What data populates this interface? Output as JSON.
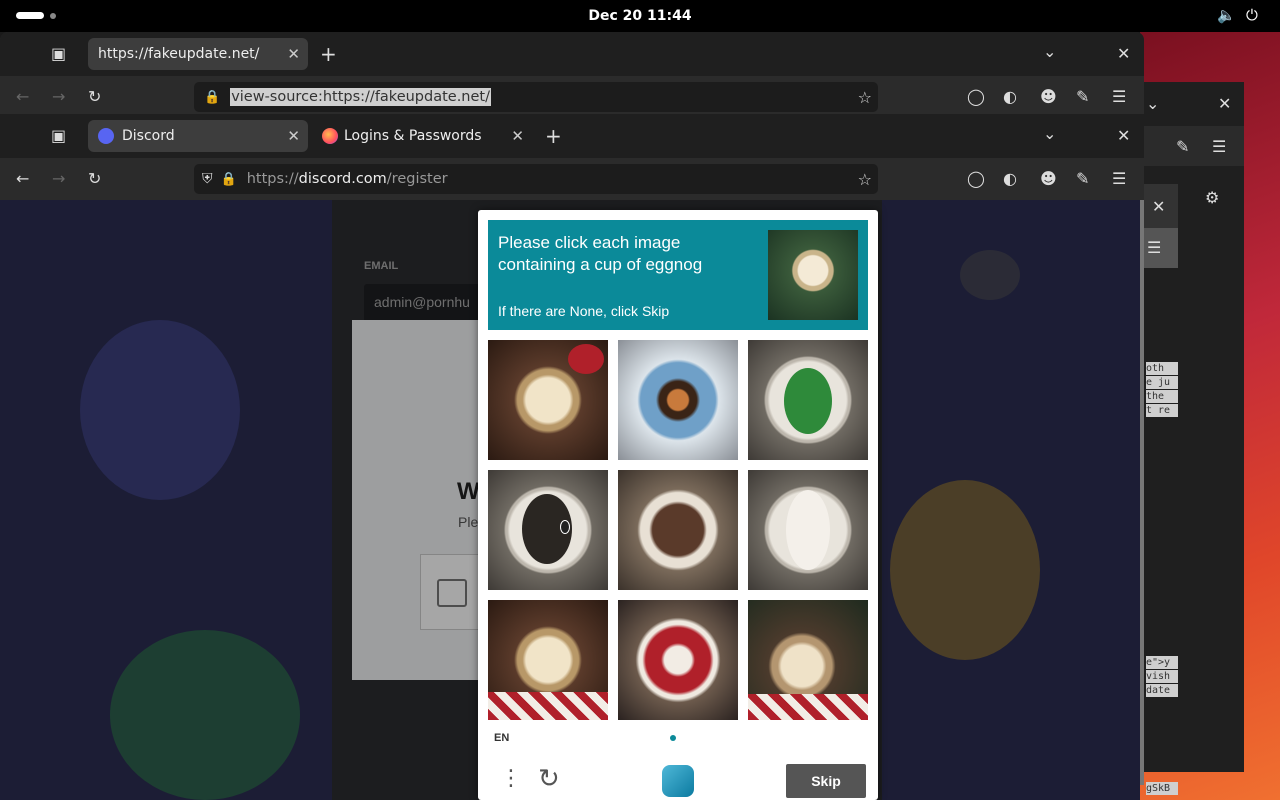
{
  "system": {
    "clock": "Dec 20  11:44"
  },
  "back_window": {
    "tab_title": "https://fakeupdate.net/",
    "url": "view-source:https://fakeupdate.net/"
  },
  "front_window": {
    "tabs": [
      {
        "title": "Discord"
      },
      {
        "title": "Logins & Passwords"
      }
    ],
    "url_prefix": "https://",
    "url_domain": "discord.com",
    "url_path": "/register"
  },
  "discord_page": {
    "email_label": "EMAIL",
    "email_value": "admin@pornhu",
    "welcome_initial": "W",
    "subtitle_initial": "Ple"
  },
  "captcha": {
    "prompt": "Please click each image containing a cup of eggnog",
    "hint": "If there are None, click Skip",
    "language": "EN",
    "skip_label": "Skip",
    "accent_color": "#0b8a99"
  },
  "right_code_snippets": [
    "oth",
    "e ju",
    " the",
    "t re",
    "e\">y",
    "vish",
    "date",
    "gSkB"
  ]
}
